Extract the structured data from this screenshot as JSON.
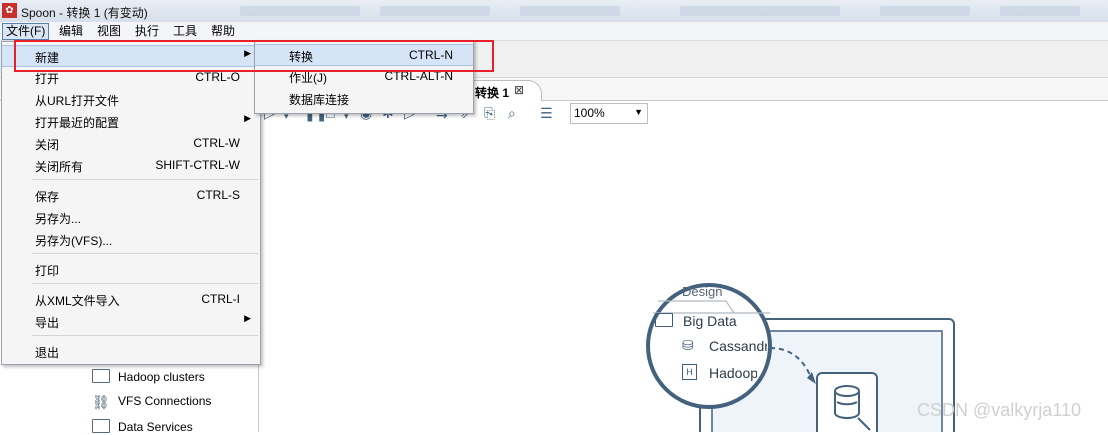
{
  "window": {
    "title": "Spoon - 转换 1 (有变动)"
  },
  "menubar": {
    "items": [
      "文件(F)",
      "编辑",
      "视图",
      "执行",
      "工具",
      "帮助"
    ]
  },
  "file_menu": {
    "items": [
      {
        "label": "新建",
        "shortcut": "",
        "submenu": true
      },
      {
        "label": "打开",
        "shortcut": "CTRL-O"
      },
      {
        "label": "从URL打开文件",
        "shortcut": ""
      },
      {
        "label": "打开最近的配置",
        "shortcut": "",
        "submenu": true
      },
      {
        "label": "关闭",
        "shortcut": "CTRL-W"
      },
      {
        "label": "关闭所有",
        "shortcut": "SHIFT-CTRL-W"
      },
      {
        "label": "保存",
        "shortcut": "CTRL-S"
      },
      {
        "label": "另存为...",
        "shortcut": ""
      },
      {
        "label": "另存为(VFS)...",
        "shortcut": ""
      },
      {
        "label": "打印",
        "shortcut": ""
      },
      {
        "label": "从XML文件导入",
        "shortcut": "CTRL-I"
      },
      {
        "label": "导出",
        "shortcut": "",
        "submenu": true
      },
      {
        "label": "退出",
        "shortcut": ""
      }
    ]
  },
  "new_submenu": {
    "items": [
      {
        "label": "转换",
        "shortcut": "CTRL-N"
      },
      {
        "label": "作业(J)",
        "shortcut": "CTRL-ALT-N"
      },
      {
        "label": "数据库连接",
        "shortcut": ""
      }
    ]
  },
  "tab": {
    "label": "转换 1",
    "close": "⊠"
  },
  "zoom": {
    "value": "100%"
  },
  "tree": {
    "items": [
      "Hadoop clusters",
      "VFS Connections",
      "Data Services"
    ]
  },
  "design_preview": {
    "tab": "Design",
    "folder": "Big Data",
    "items": [
      "Cassandr",
      "Hadoop"
    ]
  },
  "watermark": "CSDN @valkyrja110",
  "colors": {
    "highlight_box": "#e8202a",
    "menu_hover": "#d6e4f7",
    "accent": "#3f5c78"
  }
}
